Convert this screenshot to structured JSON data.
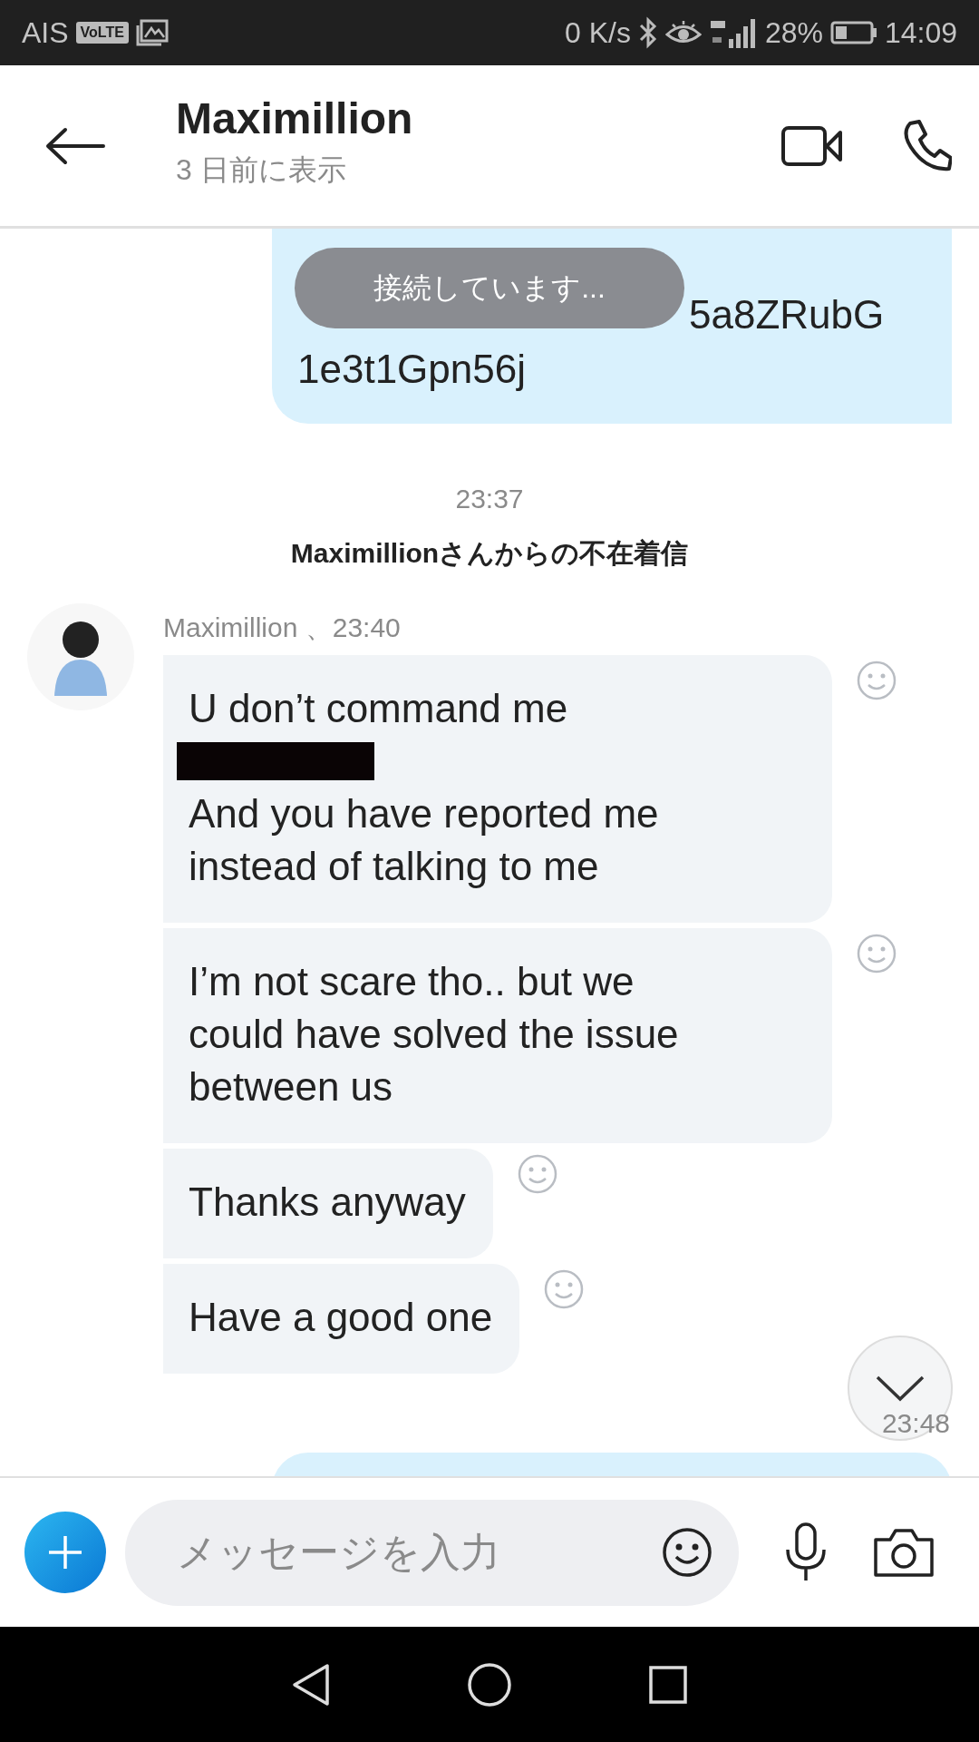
{
  "status_bar": {
    "carrier": "AIS",
    "volte": "VoLTE",
    "speed": "0 K/s",
    "battery": "28%",
    "time": "14:09"
  },
  "header": {
    "title": "Maximillion",
    "subtitle": "3 日前に表示"
  },
  "toast": "接続しています...",
  "messages": [
    {
      "kind": "outgoing",
      "lines": [
        "5a8ZRubG",
        "1e3t1Gpn56j"
      ]
    },
    {
      "kind": "time",
      "text": "23:37"
    },
    {
      "kind": "event",
      "text": "Maximillionさんからの不在着信"
    },
    {
      "kind": "incoming",
      "sender": "Maximillion 、23:40",
      "bubbles": [
        {
          "parts": [
            {
              "kind": "text",
              "text": "U don’t command me"
            },
            {
              "kind": "redacted"
            },
            {
              "kind": "text",
              "text": "And you have reported me instead of talking to me"
            }
          ]
        },
        {
          "parts": [
            {
              "kind": "text",
              "text": "I’m not scare tho.. but we could have solved the issue between us"
            }
          ]
        },
        {
          "parts": [
            {
              "kind": "text",
              "text": "Thanks anyway"
            }
          ]
        },
        {
          "parts": [
            {
              "kind": "text",
              "text": "Have a good one"
            }
          ]
        }
      ]
    },
    {
      "kind": "time_right",
      "text": "23:48"
    },
    {
      "kind": "outgoing"
    }
  ],
  "composer": {
    "placeholder": "メッセージを入力"
  }
}
